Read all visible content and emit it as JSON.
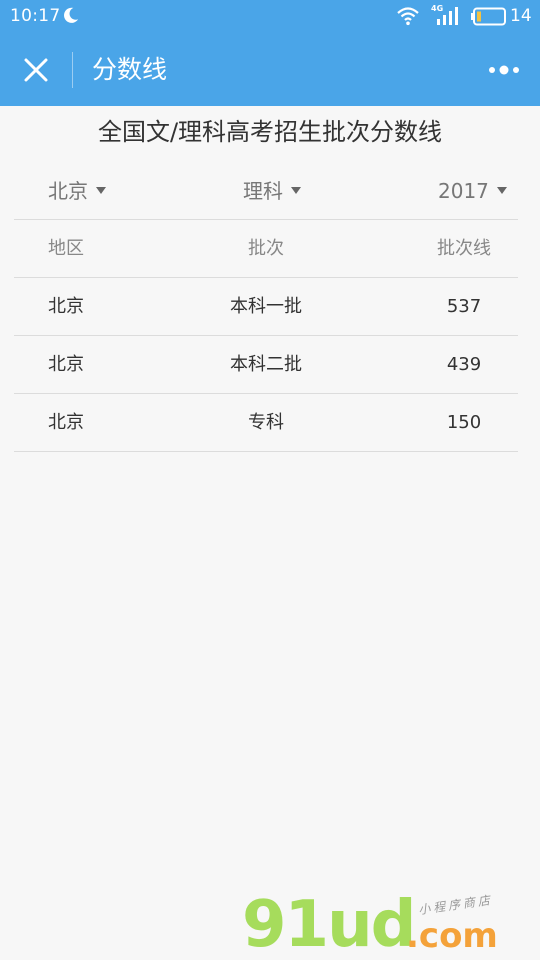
{
  "status_bar": {
    "time": "10:17",
    "network": "4G",
    "battery_level": "14"
  },
  "nav": {
    "title": "分数线"
  },
  "page": {
    "heading": "全国文/理科高考招生批次分数线"
  },
  "filters": {
    "region": "北京",
    "subject": "理科",
    "year": "2017"
  },
  "table": {
    "headers": [
      "地区",
      "批次",
      "批次线"
    ],
    "rows": [
      [
        "北京",
        "本科一批",
        "537"
      ],
      [
        "北京",
        "本科二批",
        "439"
      ],
      [
        "北京",
        "专科",
        "150"
      ]
    ]
  },
  "watermark": {
    "brand": "91ud",
    "domain": ".com",
    "tagline": "小程序商店"
  },
  "colors": {
    "accent": "#4aa5e8",
    "background": "#f7f7f7",
    "divider": "#dcdcdc"
  }
}
